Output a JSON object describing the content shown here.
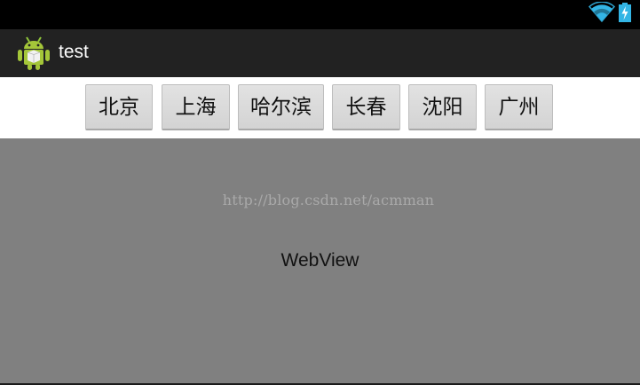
{
  "status_bar": {
    "icons": [
      "wifi-icon",
      "battery-charging-icon"
    ],
    "accent_color": "#33b5e5"
  },
  "action_bar": {
    "app_icon": "android-robot-icon",
    "title": "test"
  },
  "buttons": [
    {
      "label": "北京"
    },
    {
      "label": "上海"
    },
    {
      "label": "哈尔滨"
    },
    {
      "label": "长春"
    },
    {
      "label": "沈阳"
    },
    {
      "label": "广州"
    }
  ],
  "webview": {
    "watermark": "http://blog.csdn.net/acmman",
    "label": "WebView",
    "background_color": "#808080"
  }
}
